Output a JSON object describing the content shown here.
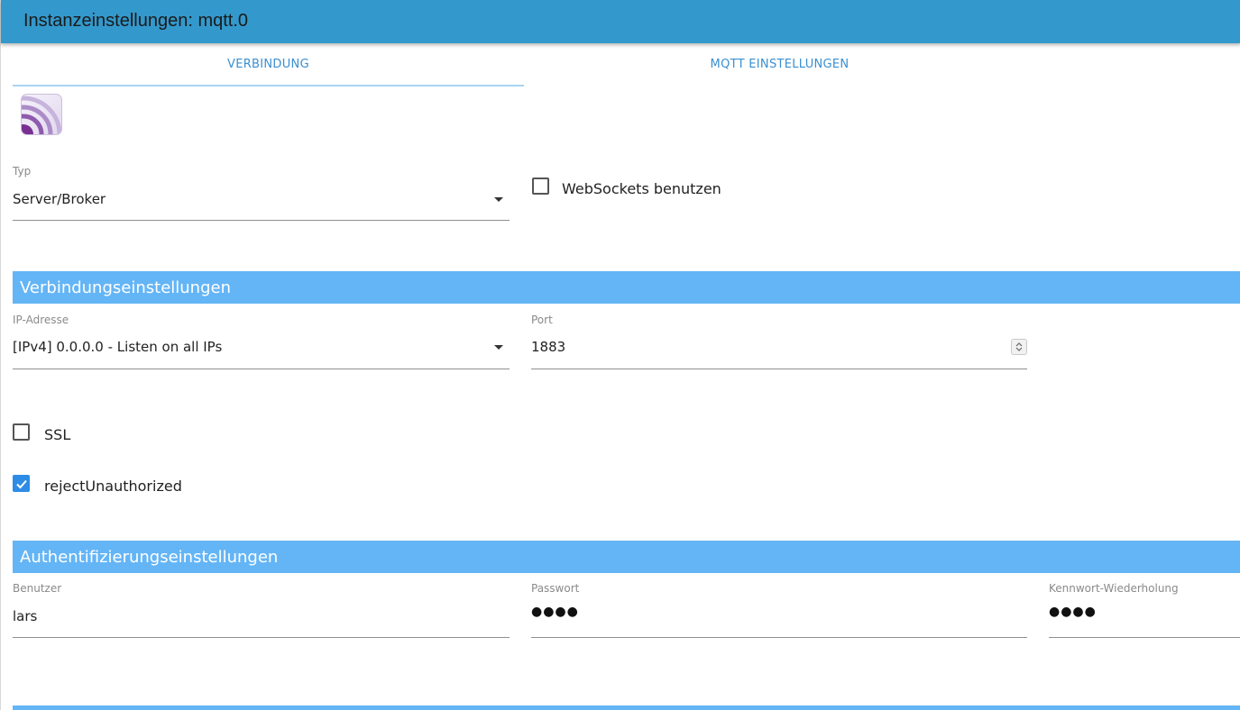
{
  "window": {
    "title": "Instanzeinstellungen: mqtt.0"
  },
  "tabs": [
    {
      "label": "VERBINDUNG",
      "active": true
    },
    {
      "label": "MQTT EINSTELLUNGEN",
      "active": false
    }
  ],
  "connection": {
    "type_label": "Typ",
    "type_value": "Server/Broker",
    "websockets_label": "WebSockets benutzen",
    "websockets_checked": false
  },
  "connection_settings": {
    "header": "Verbindungseinstellungen",
    "ip_label": "IP-Adresse",
    "ip_value": "[IPv4] 0.0.0.0 - Listen on all IPs",
    "port_label": "Port",
    "port_value": "1883",
    "ssl_label": "SSL",
    "ssl_checked": false,
    "reject_label": "rejectUnauthorized",
    "reject_checked": true
  },
  "auth_settings": {
    "header": "Authentifizierungseinstellungen",
    "user_label": "Benutzer",
    "user_value": "lars",
    "password_label": "Passwort",
    "password_mask": "●●●●",
    "repeat_label": "Kennwort-Wiederholung",
    "repeat_mask": "●●●●"
  },
  "colors": {
    "titlebar": "#3399cc",
    "section_header": "#64b5f6",
    "tab_text": "#3a8fd0",
    "checkbox_checked": "#2d8ce6"
  },
  "icons": {
    "logo": "mqtt-broadcast-logo-icon",
    "dropdown": "caret-down-icon",
    "check": "check-icon",
    "spinner": "spinner-arrows-icon"
  }
}
